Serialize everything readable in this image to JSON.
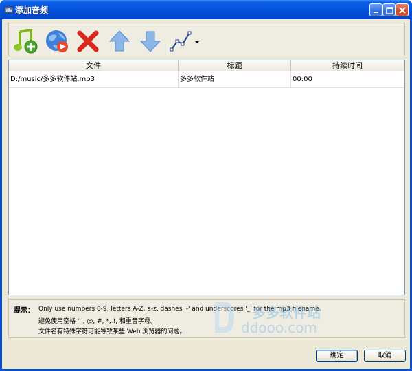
{
  "window": {
    "title": "添加音频"
  },
  "toolbar": {
    "add_audio": "add-music-icon",
    "add_online": "globe-play-icon",
    "remove": "delete-icon",
    "move_up": "arrow-up-icon",
    "move_down": "arrow-down-icon",
    "envelope": "curve-dropdown-icon"
  },
  "table": {
    "columns": [
      "文件",
      "标题",
      "持续时间"
    ],
    "rows": [
      {
        "file": "D:/music/多多软件站.mp3",
        "title": "多多软件站",
        "duration": "00:00"
      }
    ]
  },
  "hint": {
    "label": "提示：",
    "line1": "Only use numbers 0-9, letters A-Z, a-z, dashes '-' and underscores '_' for the mp3 filename.",
    "line2": "避免使用空格 ' ', @, #, *, !, 和重音字母。",
    "line3": "文件名有特殊字符可能导致某些 Web 浏览器的问题。"
  },
  "watermark": {
    "cn": "多多软件站",
    "en": "ddooo.com"
  },
  "buttons": {
    "ok": "确定",
    "cancel": "取消"
  },
  "colors": {
    "titlebar": "#0753dc",
    "dialog_bg": "#ece9d8",
    "list_border": "#7f9db9"
  }
}
